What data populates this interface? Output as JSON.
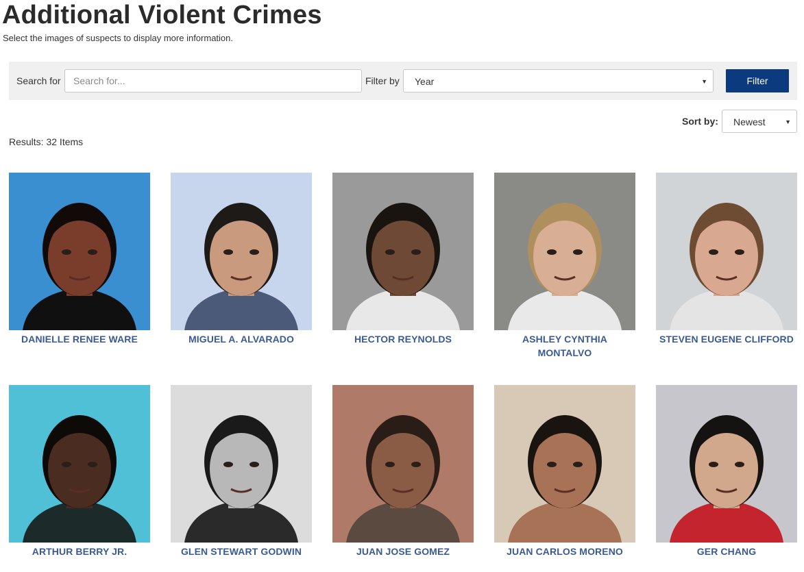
{
  "page": {
    "title": "Additional Violent Crimes",
    "subtitle": "Select the images of suspects to display more information."
  },
  "filter": {
    "search_label": "Search for",
    "search_placeholder": "Search for...",
    "search_value": "",
    "filter_by_label": "Filter by",
    "year_selected": "Year",
    "button_label": "Filter",
    "button_color": "#0b3a7e"
  },
  "sort": {
    "label": "Sort by:",
    "selected": "Newest"
  },
  "results": {
    "text": "Results: 32 Items"
  },
  "suspects": [
    {
      "name": "DANIELLE RENEE WARE",
      "bg": "#3a8fd0",
      "skin": "#7a3d2c",
      "hair": "#120a08",
      "shirt": "#101010",
      "icon": "suspect-photo"
    },
    {
      "name": "MIGUEL A. ALVARADO",
      "bg": "#c7d6ec",
      "skin": "#c99a7e",
      "hair": "#1e1a18",
      "shirt": "#4b5a78",
      "icon": "suspect-photo"
    },
    {
      "name": "HECTOR REYNOLDS",
      "bg": "#9a9a9a",
      "skin": "#6e4a36",
      "hair": "#1a1410",
      "shirt": "#e8e8e8",
      "icon": "suspect-photo"
    },
    {
      "name": "ASHLEY CYNTHIA MONTALVO",
      "bg": "#8a8a86",
      "skin": "#d8ae94",
      "hair": "#b08f5e",
      "shirt": "#e9e9e9",
      "icon": "suspect-photo"
    },
    {
      "name": "STEVEN EUGENE CLIFFORD",
      "bg": "#d0d4d6",
      "skin": "#d8a890",
      "hair": "#6e4b33",
      "shirt": "#e4e4e4",
      "icon": "suspect-photo"
    },
    {
      "name": "ARTHUR BERRY JR.",
      "bg": "#4fc0d6",
      "skin": "#4a2c20",
      "hair": "#0d0a08",
      "shirt": "#1c2a2a",
      "icon": "suspect-photo"
    },
    {
      "name": "GLEN STEWART GODWIN",
      "bg": "#dcdcdc",
      "skin": "#b8b8b8",
      "hair": "#1a1a1a",
      "shirt": "#2a2a2a",
      "icon": "suspect-photo"
    },
    {
      "name": "JUAN JOSE GOMEZ",
      "bg": "#b07a68",
      "skin": "#8a5c46",
      "hair": "#2a1c16",
      "shirt": "#5a4a40",
      "icon": "suspect-photo"
    },
    {
      "name": "JUAN CARLOS MORENO",
      "bg": "#d8c8b6",
      "skin": "#a87256",
      "hair": "#1a1410",
      "shirt": "#a87256",
      "icon": "suspect-photo"
    },
    {
      "name": "GER CHANG",
      "bg": "#c6c6cc",
      "skin": "#d2a88c",
      "hair": "#151212",
      "shirt": "#c4242e",
      "icon": "suspect-photo"
    }
  ]
}
